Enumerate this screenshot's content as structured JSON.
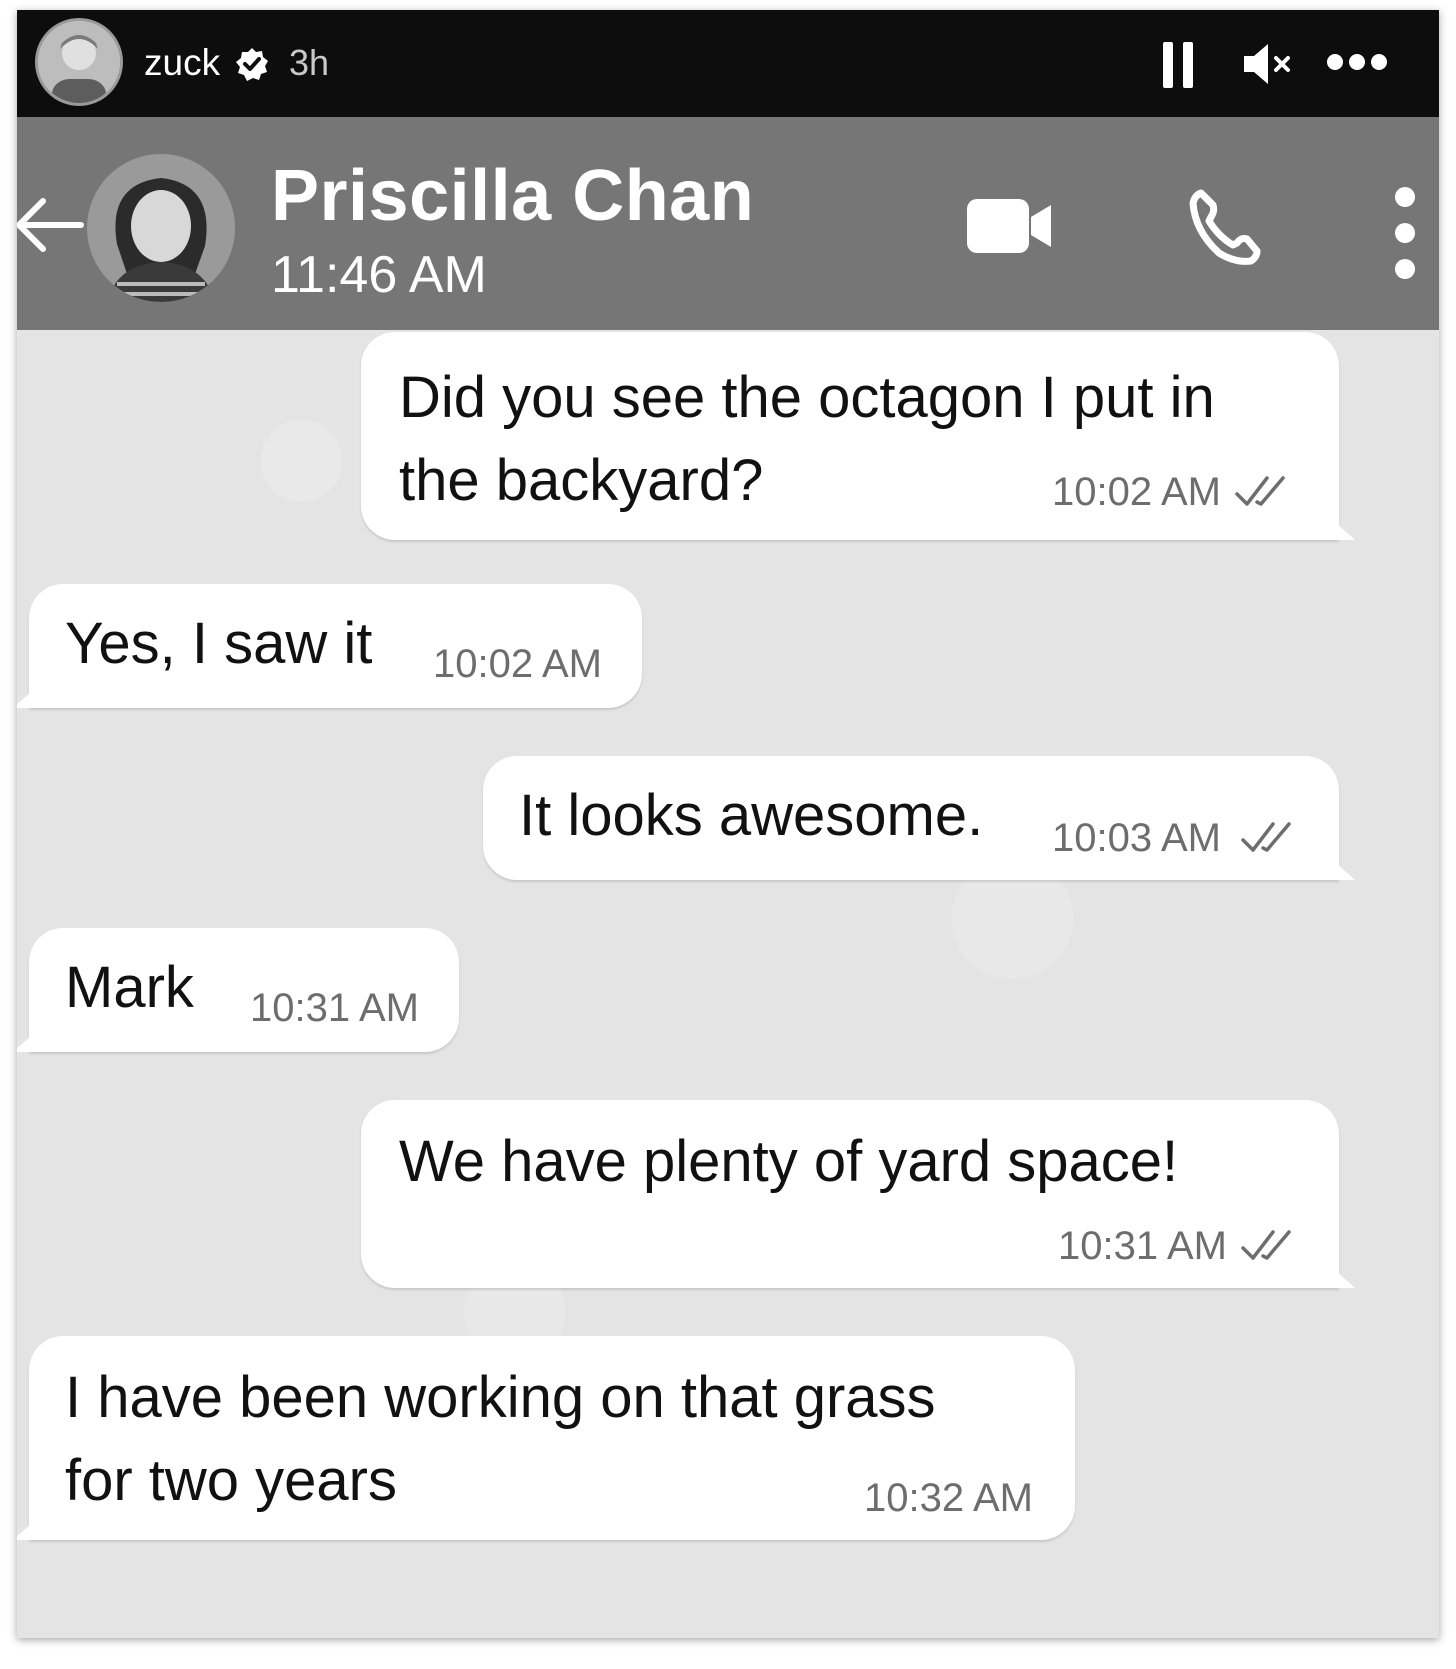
{
  "story": {
    "username": "zuck",
    "time_ago": "3h"
  },
  "chat_header": {
    "contact_name": "Priscilla Chan",
    "status": "11:46 AM"
  },
  "messages": [
    {
      "direction": "outgoing",
      "text": "Did you see the octagon I put in\nthe backyard?",
      "time": "10:02 AM",
      "read": true
    },
    {
      "direction": "incoming",
      "text": "Yes, I saw it",
      "time": "10:02 AM"
    },
    {
      "direction": "outgoing",
      "text": "It looks awesome.",
      "time": "10:03 AM",
      "read": true
    },
    {
      "direction": "incoming",
      "text": "Mark",
      "time": "10:31 AM"
    },
    {
      "direction": "outgoing",
      "text": "We have plenty of yard space!",
      "time": "10:31 AM",
      "read": true
    },
    {
      "direction": "incoming",
      "text": "I have been working on that grass\nfor two years",
      "time": "10:32 AM"
    }
  ],
  "icons": {
    "story_bar": [
      "avatar",
      "verified-badge-icon",
      "pause-icon",
      "mute-icon",
      "more-icon"
    ],
    "chat_header": [
      "back-arrow-icon",
      "contact-avatar",
      "video-call-icon",
      "phone-icon",
      "menu-icon"
    ],
    "message": [
      "double-check-icon"
    ]
  }
}
